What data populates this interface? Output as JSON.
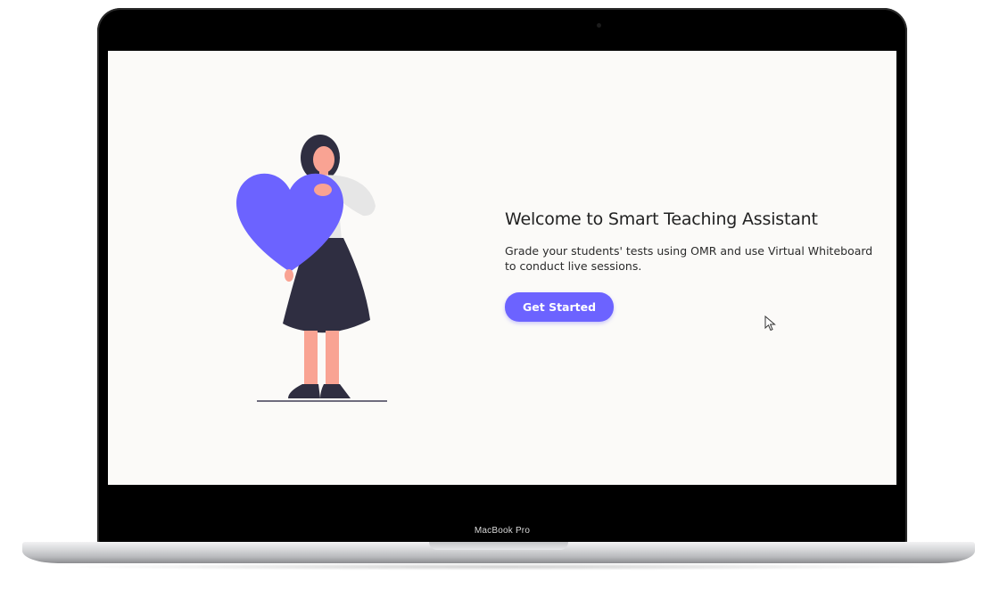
{
  "device": {
    "label": "MacBook Pro"
  },
  "welcome": {
    "title": "Welcome to Smart Teaching Assistant",
    "subtitle": "Grade your students' tests using OMR and use Virtual Whiteboard to conduct live sessions.",
    "cta_label": "Get Started"
  },
  "illustration": {
    "icon": "woman-holding-heart-illustration",
    "accent_color": "#6c63ff"
  },
  "colors": {
    "accent": "#6c63ff",
    "screen_background": "#fbfaf8",
    "bezel": "#000000"
  }
}
